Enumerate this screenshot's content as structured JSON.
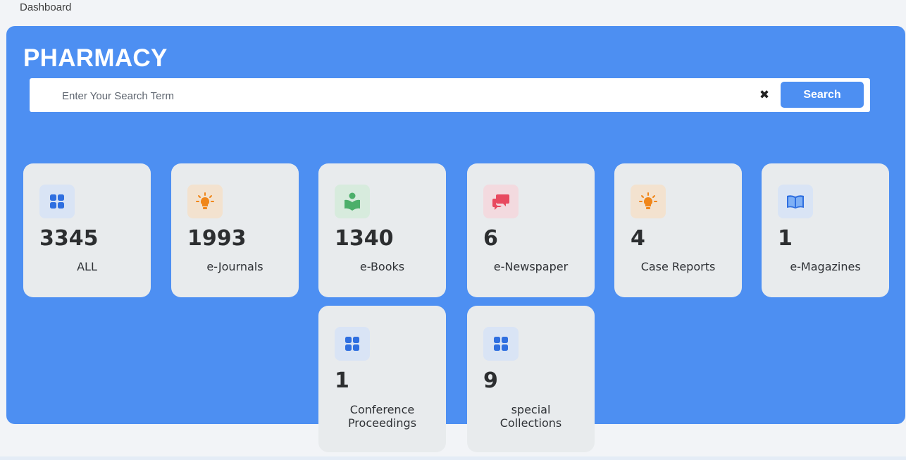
{
  "breadcrumb": "Dashboard",
  "hero": {
    "title": "PHARMACY",
    "background_color": "#4d8ff2"
  },
  "search": {
    "placeholder": "Enter Your Search Term",
    "value": "",
    "clear_icon": "close-icon",
    "button_label": "Search"
  },
  "cards": [
    {
      "count": "3345",
      "label": "ALL",
      "icon": "grid-icon",
      "icon_bg": "#d9e4f5",
      "icon_color": "#2f6fe0"
    },
    {
      "count": "1993",
      "label": "e-Journals",
      "icon": "lightbulb-icon",
      "icon_bg": "#f3e2cf",
      "icon_color": "#f0861a"
    },
    {
      "count": "1340",
      "label": "e-Books",
      "icon": "reader-icon",
      "icon_bg": "#d7ebdd",
      "icon_color": "#4caf6a"
    },
    {
      "count": "6",
      "label": "e-Newspaper",
      "icon": "chat-icon",
      "icon_bg": "#f3dadf",
      "icon_color": "#e84a60"
    },
    {
      "count": "4",
      "label": "Case Reports",
      "icon": "lightbulb-icon",
      "icon_bg": "#f3e2cf",
      "icon_color": "#f0861a"
    },
    {
      "count": "1",
      "label": "e-Magazines",
      "icon": "book-open-icon",
      "icon_bg": "#d9e4f5",
      "icon_color": "#2f6fe0"
    },
    {
      "count": "1",
      "label": "Conference Proceedings",
      "icon": "grid-icon",
      "icon_bg": "#d9e4f5",
      "icon_color": "#2f6fe0"
    },
    {
      "count": "9",
      "label": "special Collections",
      "icon": "grid-icon",
      "icon_bg": "#d9e4f5",
      "icon_color": "#2f6fe0"
    }
  ]
}
